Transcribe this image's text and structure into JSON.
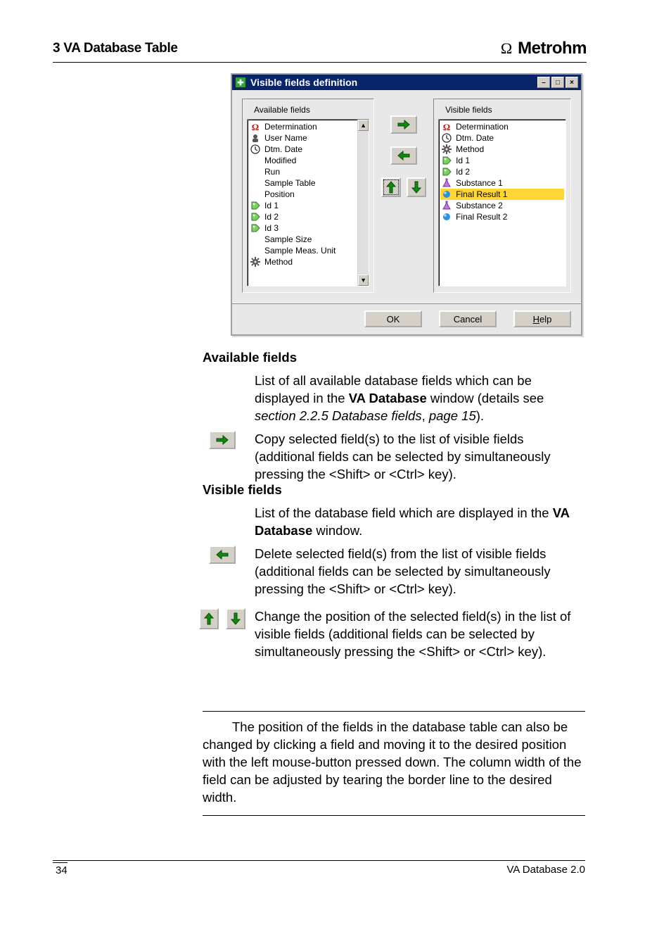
{
  "header": {
    "chapter": "3  VA Database Table",
    "brand": "Metrohm"
  },
  "dialog": {
    "title": "Visible fields definition",
    "availableLabel": "Available fields",
    "visibleLabel": "Visible fields",
    "available": [
      {
        "icon": "omega",
        "label": "Determination"
      },
      {
        "icon": "user",
        "label": "User Name"
      },
      {
        "icon": "clock",
        "label": "Dtm. Date"
      },
      {
        "icon": "",
        "label": "Modified"
      },
      {
        "icon": "",
        "label": "Run"
      },
      {
        "icon": "",
        "label": "Sample Table"
      },
      {
        "icon": "",
        "label": "Position"
      },
      {
        "icon": "tag",
        "label": "Id 1"
      },
      {
        "icon": "tag",
        "label": "Id 2"
      },
      {
        "icon": "tag",
        "label": "Id 3"
      },
      {
        "icon": "",
        "label": "Sample Size"
      },
      {
        "icon": "",
        "label": "Sample Meas. Unit"
      },
      {
        "icon": "gear",
        "label": "Method"
      }
    ],
    "visible": [
      {
        "icon": "omega",
        "label": "Determination",
        "hl": false
      },
      {
        "icon": "clock",
        "label": "Dtm. Date",
        "hl": false
      },
      {
        "icon": "gear",
        "label": "Method",
        "hl": false
      },
      {
        "icon": "tag",
        "label": "Id 1",
        "hl": false
      },
      {
        "icon": "tag",
        "label": "Id 2",
        "hl": false
      },
      {
        "icon": "flask",
        "label": "Substance 1",
        "hl": false
      },
      {
        "icon": "ball",
        "label": "Final Result 1",
        "hl": true
      },
      {
        "icon": "flask",
        "label": "Substance 2",
        "hl": false
      },
      {
        "icon": "ball",
        "label": "Final Result 2",
        "hl": false
      }
    ],
    "buttons": {
      "ok": "OK",
      "cancel": "Cancel",
      "help": "Help"
    }
  },
  "text": {
    "availHeading": "Available fields",
    "availPara": {
      "p1a": "List of all available database fields which can be displayed in the ",
      "p1b": "VA Database",
      "p1c": " window (details see ",
      "p1d": "section 2.2.5 Database fields",
      "p1e": ", ",
      "p1f": "page 15",
      "p1g": ")."
    },
    "copyDesc": "Copy selected field(s) to the list of visible fields (additional fields can be selected by simultaneously pressing the <Shift> or <Ctrl> key).",
    "visHeading": "Visible fields",
    "visPara": {
      "a": "List of the database field which are displayed in the ",
      "b": "VA Database",
      "c": " window."
    },
    "deleteDesc": "Delete selected field(s) from the list of visible fields (additional fields can be selected by simultaneously pressing the <Shift> or <Ctrl> key).",
    "moveDesc": "Change the position of the selected field(s) in the list of visible fields (additional fields can be selected by simultaneously pressing the <Shift> or <Ctrl> key).",
    "note": "The position of the fields in the database table can also be changed by clicking a field and moving it to the desired position with the left mouse-button pressed down. The column width of the field can be adjusted by tearing the border line to the desired width."
  },
  "footer": {
    "pageNum": "34",
    "product": "VA Database 2.0"
  }
}
